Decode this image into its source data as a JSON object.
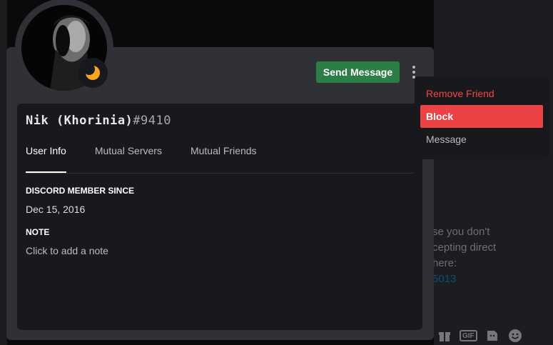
{
  "profile": {
    "username": "Nik (Khorinia)",
    "discriminator": "#9410",
    "send_message_label": "Send Message",
    "status": "idle"
  },
  "tabs": [
    {
      "label": "User Info",
      "active": true
    },
    {
      "label": "Mutual Servers",
      "active": false
    },
    {
      "label": "Mutual Friends",
      "active": false
    }
  ],
  "user_info": {
    "member_since_heading": "DISCORD MEMBER SINCE",
    "member_since_value": "Dec 15, 2016",
    "note_heading": "NOTE",
    "note_placeholder": "Click to add a note"
  },
  "context_menu": {
    "items": [
      {
        "label": "Remove Friend",
        "style": "danger"
      },
      {
        "label": "Block",
        "style": "focused"
      },
      {
        "label": "Message",
        "style": "normal"
      }
    ]
  },
  "background": {
    "notice_lines": [
      "se you don't",
      "cepting direct",
      "here:",
      "5013"
    ]
  },
  "colors": {
    "popout_bg": "#2f3136",
    "inner_bg": "#18191c",
    "send_button": "#2d7d46",
    "block_highlight": "#ed4245",
    "danger_text": "#f04747",
    "idle_status": "#faa81a"
  },
  "icons": [
    "more-vertical-icon",
    "moon-status-icon",
    "gift-icon",
    "gif-icon",
    "sticker-icon",
    "emoji-icon"
  ]
}
